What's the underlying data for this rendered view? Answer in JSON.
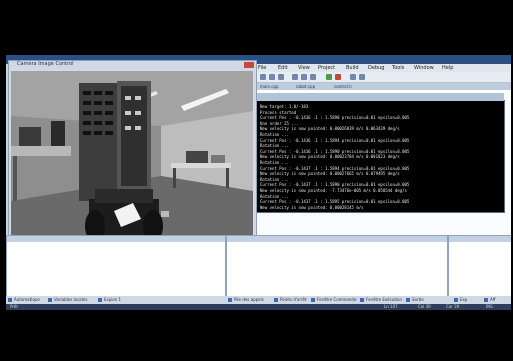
{
  "camera_window": {
    "title": "Camera Image Control"
  },
  "ide": {
    "menu": [
      "File",
      "Edit",
      "View",
      "Project",
      "Build",
      "Debug",
      "Tools",
      "Window",
      "Help"
    ],
    "tabs": [
      "main.cpp",
      "robot.cpp",
      "control.h"
    ]
  },
  "console": {
    "lines": [
      "New target: 1.0/-183",
      "Process started",
      "Current Pos : -0.1436  .1 : 1.5890  precision=0.01 epsilon=0.005",
      "One order 25 ...",
      "New velocity is now pointed: 0.00026839 m/s 0.063439 deg/s",
      "Rotation ...",
      "Current Pos : -0.1436  .1 : 1.5894  precision=0.01 epsilon=0.005",
      "Rotation ...",
      "Current Pos : -0.1436  .1 : 1.5890  precision=0.01 epsilon=0.005",
      "New velocity is now pointed: 0.00023784 m/s 0.081823 deg/s",
      "Rotation ...",
      "Current Pos : -0.1437  .1 : 1.5894  precision=0.01 epsilon=0.005",
      "New velocity is now pointed: 0.00027665 m/s 0.079495 deg/s",
      "Rotation ...",
      "Current Pos : -0.1437  .1 : 1.5890  precision=0.01 epsilon=0.005",
      "New velocity is now pointed: -7.73476e-005 m/s 0.058544 deg/s",
      "Rotation ...",
      "Current Pos : -0.1437  .1 : 1.5895  precision=0.01 epsilon=0.005",
      "New velocity is now pointed: 0.00028145 m/s"
    ]
  },
  "taskbar": {
    "items": [
      "Automatique",
      "Variables locales",
      "Espion 1",
      "Pile des appels",
      "Points d'arrêt",
      "Fenêtre Commande",
      "Fenêtre Exécution",
      "Sortie"
    ],
    "right_items": [
      "Exp",
      "Aff"
    ]
  },
  "statusbar": {
    "left": "Prêt",
    "ln": "Ln 107",
    "col": "Col 39",
    "ch": "Car 39",
    "ins": "INS"
  }
}
